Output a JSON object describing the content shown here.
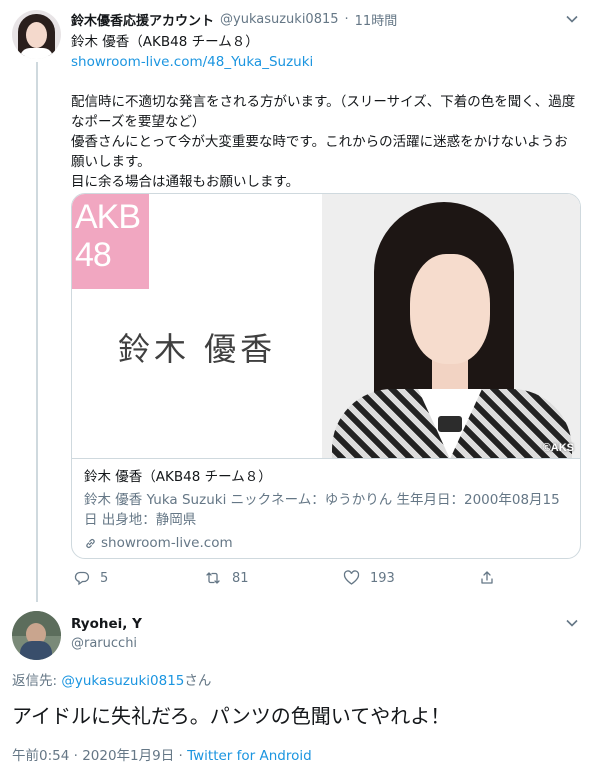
{
  "parent": {
    "display_name": "鈴木優香応援アカウント",
    "handle": "@yukasuzuki0815",
    "separator": "·",
    "time": "11時間",
    "text_line1": "鈴木 優香（AKB48 チーム８）",
    "link": "showroom-live.com/48_Yuka_Suzuki",
    "text_body1": "配信時に不適切な発言をされる方がいます。（スリーサイズ、下着の色を聞く、過度なポーズを要望など）",
    "text_body2": "優香さんにとって今が大変重要な時です。これからの活躍に迷惑をかけないようお願いします。",
    "text_body3": "目に余る場合は通報もお願いします。",
    "card": {
      "logo_text": "AKB 48",
      "image_name": "鈴木 優香",
      "watermark": "©AKS",
      "title": "鈴木 優香（AKB48 チーム８）",
      "description": "鈴木 優香 Yuka Suzuki ニックネーム：ゆうかりん 生年月日：2000年08月15日 出身地：静岡県",
      "domain": "showroom-live.com"
    },
    "actions": {
      "reply_count": "5",
      "retweet_count": "81",
      "like_count": "193"
    }
  },
  "reply": {
    "display_name": "Ryohei, Y",
    "handle": "@rarucchi",
    "reply_to_prefix": "返信先: ",
    "reply_to_handle": "@yukasuzuki0815",
    "reply_to_suffix": "さん",
    "text": "アイドルに失礼だろ。パンツの色聞いてやれよ！",
    "timestamp": "午前0:54 · 2020年1月9日 · ",
    "source": "Twitter for Android"
  },
  "colors": {
    "link": "#1b95e0",
    "secondary_text": "#657786",
    "akb_pink": "#f1a7c1"
  }
}
